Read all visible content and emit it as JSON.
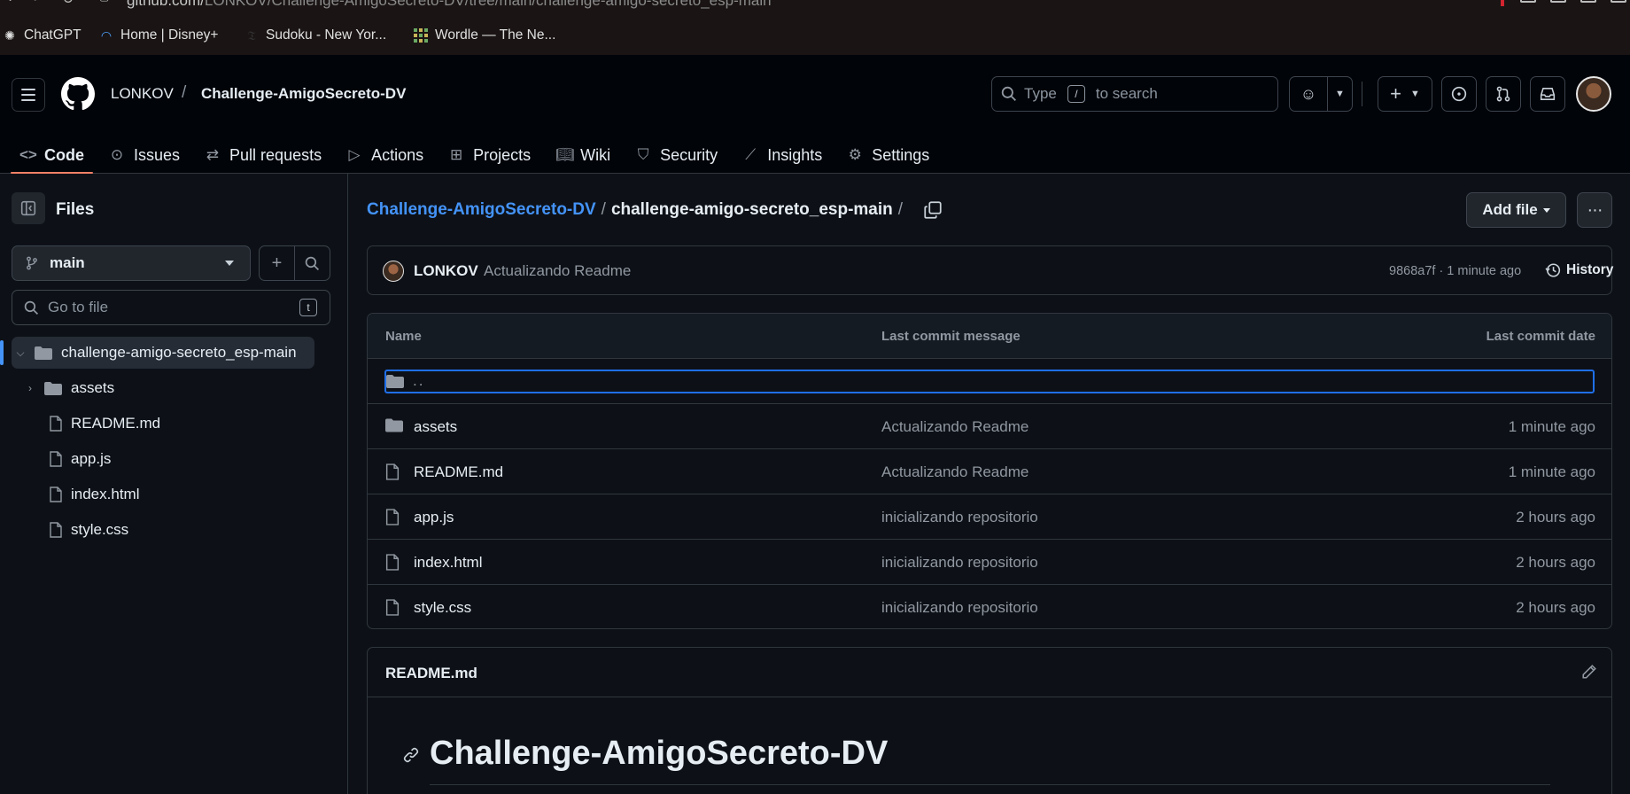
{
  "browser": {
    "url_host": "github.com/",
    "url_path": "LONKOV/Challenge-AmigoSecreto-DV/tree/main/challenge-amigo-secreto_esp-main",
    "bookmarks": [
      {
        "label": "ChatGPT",
        "icon": "chatgpt-icon"
      },
      {
        "label": "Home | Disney+",
        "icon": "disney-icon"
      },
      {
        "label": "Sudoku - New Yor...",
        "icon": "nyt-icon"
      },
      {
        "label": "Wordle — The Ne...",
        "icon": "wordle-icon"
      }
    ]
  },
  "header": {
    "owner": "LONKOV",
    "separator": "/",
    "repo": "Challenge-AmigoSecreto-DV",
    "search": {
      "prefix": "Type",
      "key": "/",
      "suffix": "to search"
    }
  },
  "tabs": [
    {
      "label": "Code",
      "icon": "code-icon",
      "active": true
    },
    {
      "label": "Issues",
      "icon": "issue-icon"
    },
    {
      "label": "Pull requests",
      "icon": "pull-request-icon"
    },
    {
      "label": "Actions",
      "icon": "play-icon"
    },
    {
      "label": "Projects",
      "icon": "table-icon"
    },
    {
      "label": "Wiki",
      "icon": "book-icon"
    },
    {
      "label": "Security",
      "icon": "shield-icon"
    },
    {
      "label": "Insights",
      "icon": "graph-icon"
    },
    {
      "label": "Settings",
      "icon": "gear-icon"
    }
  ],
  "sidebar": {
    "title": "Files",
    "branch": "main",
    "goto_placeholder": "Go to file",
    "goto_key": "t",
    "tree": [
      {
        "label": "challenge-amigo-secreto_esp-main",
        "type": "folder-open"
      },
      {
        "label": "assets",
        "type": "folder"
      },
      {
        "label": "README.md",
        "type": "file"
      },
      {
        "label": "app.js",
        "type": "file"
      },
      {
        "label": "index.html",
        "type": "file"
      },
      {
        "label": "style.css",
        "type": "file"
      }
    ]
  },
  "main": {
    "path_repo": "Challenge-AmigoSecreto-DV",
    "path_sep": "/",
    "path_current": "challenge-amigo-secreto_esp-main",
    "add_file": "Add file",
    "more": "···",
    "commit": {
      "author": "LONKOV",
      "message": "Actualizando Readme",
      "sha_time": "9868a7f · 1 minute ago",
      "history": "History"
    },
    "table": {
      "headers": {
        "name": "Name",
        "message": "Last commit message",
        "date": "Last commit date"
      },
      "parent": "..",
      "rows": [
        {
          "name": "assets",
          "type": "folder",
          "message": "Actualizando Readme",
          "date": "1 minute ago"
        },
        {
          "name": "README.md",
          "type": "file",
          "message": "Actualizando Readme",
          "date": "1 minute ago"
        },
        {
          "name": "app.js",
          "type": "file",
          "message": "inicializando repositorio",
          "date": "2 hours ago"
        },
        {
          "name": "index.html",
          "type": "file",
          "message": "inicializando repositorio",
          "date": "2 hours ago"
        },
        {
          "name": "style.css",
          "type": "file",
          "message": "inicializando repositorio",
          "date": "2 hours ago"
        }
      ]
    },
    "readme": {
      "filename": "README.md",
      "heading": "Challenge-AmigoSecreto-DV"
    }
  },
  "colors": {
    "accent_link": "#4493f8",
    "tab_underline": "#f78166",
    "bg": "#0d1117",
    "header_bg": "#010409"
  }
}
